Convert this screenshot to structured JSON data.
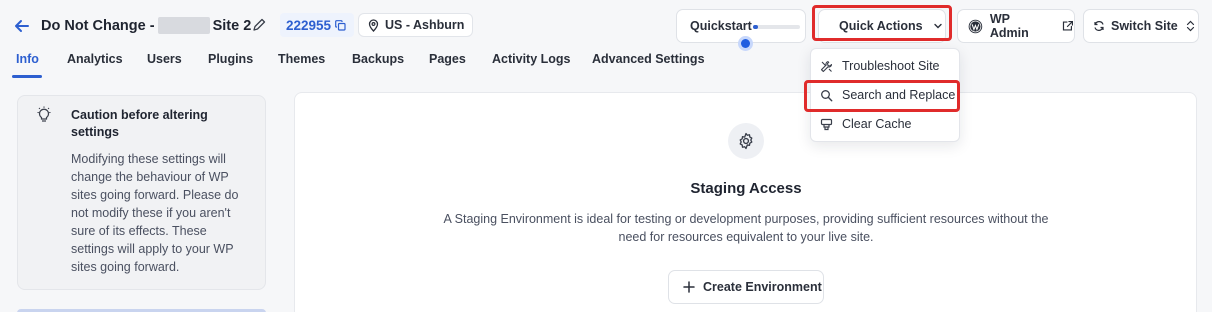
{
  "header": {
    "site_name_prefix": "Do Not Change - ",
    "site_name_suffix": "Site 2",
    "site_id": "222955",
    "location": "US - Ashburn",
    "quickstart_label": "Quickstart",
    "quickstart_progress": 0.1,
    "quick_actions_label": "Quick Actions",
    "wp_admin_label": "WP Admin",
    "switch_site_label": "Switch Site"
  },
  "tabs": [
    "Info",
    "Analytics",
    "Users",
    "Plugins",
    "Themes",
    "Backups",
    "Pages",
    "Activity Logs",
    "Advanced Settings"
  ],
  "active_tab": "Info",
  "caution": {
    "title": "Caution before altering settings",
    "body": "Modifying these settings will change the behaviour of WP sites going forward. Please do not modify these if you aren't sure of its effects. These settings will apply to your WP sites going forward."
  },
  "staging": {
    "title": "Staging Access",
    "description": "A Staging Environment is ideal for testing or development purposes, providing sufficient resources without the need for resources equivalent to your live site.",
    "create_button": "Create Environment"
  },
  "quick_actions_menu": {
    "items": [
      {
        "label": "Troubleshoot Site",
        "icon": "tools-icon"
      },
      {
        "label": "Search and Replace",
        "icon": "search-icon"
      },
      {
        "label": "Clear Cache",
        "icon": "cache-icon"
      }
    ]
  },
  "colors": {
    "accent": "#2d5fd0",
    "highlight": "#e02b2b"
  }
}
